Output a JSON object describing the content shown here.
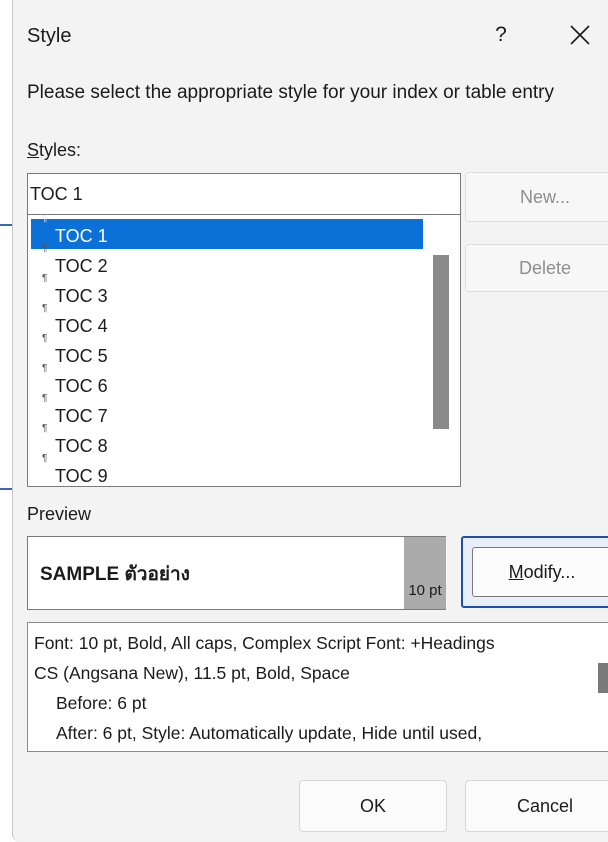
{
  "dialog": {
    "title": "Style",
    "help_label": "?",
    "instruction": "Please select the appropriate style for your index or table entry"
  },
  "styles": {
    "label_accesskey": "S",
    "label_rest": "tyles:",
    "input_value": "TOC 1",
    "pilcrow": "¶",
    "items": [
      {
        "label": "TOC 1",
        "selected": true
      },
      {
        "label": "TOC 2"
      },
      {
        "label": "TOC 3"
      },
      {
        "label": "TOC 4"
      },
      {
        "label": "TOC 5"
      },
      {
        "label": "TOC 6"
      },
      {
        "label": "TOC 7"
      },
      {
        "label": "TOC 8"
      },
      {
        "label": "TOC 9"
      }
    ]
  },
  "buttons": {
    "new": "New...",
    "delete": "Delete",
    "modify_accesskey": "M",
    "modify_rest": "odify...",
    "ok": "OK",
    "cancel": "Cancel"
  },
  "preview": {
    "label": "Preview",
    "sample_text": "SAMPLE ตัวอย่าง",
    "size": "10 pt"
  },
  "description": {
    "lines": [
      "Font: 10 pt, Bold, All caps, Complex Script Font: +Headings",
      "CS (Angsana New), 11.5 pt, Bold, Space",
      "Before:  6 pt",
      "After:  6 pt, Style: Automatically update, Hide until used,"
    ]
  },
  "colors": {
    "selection": "#0b71d9",
    "focus_border": "#1f4fad",
    "dialog_background": "#f3f3f3"
  }
}
